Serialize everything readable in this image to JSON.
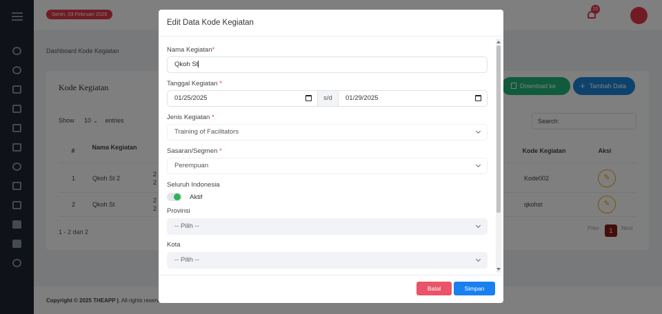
{
  "topbar": {
    "date": "Senin, 03 Februari 2025",
    "notification_count": "20"
  },
  "breadcrumb": "Dashboard Kode Kegiatan",
  "card": {
    "title": "Kode Kegiatan",
    "excel_button": "Download ke Excel",
    "add_button": "Tambah Data",
    "show_label": "Show",
    "entries_value": "10",
    "entries_label": "entries",
    "search_label": "Search:"
  },
  "table": {
    "headers": [
      "#",
      "Nama Kegiatan",
      "Kode Kegiatan",
      "Aksi"
    ],
    "rows": [
      {
        "no": "1",
        "nama": "Qkoh St 2",
        "date_a": "2",
        "date_b": "2",
        "kode": "Kode002"
      },
      {
        "no": "2",
        "nama": "Qkoh St",
        "date_a": "2",
        "date_b": "2",
        "kode": "qkohst"
      }
    ]
  },
  "pagination": {
    "info": "1 - 2 dari 2",
    "prev": "Prev",
    "current": "1",
    "next": "Next"
  },
  "footer": {
    "copyright_bold": "Copyright © 2025 THEAPP |",
    "copyright_rest": ". All rights reserv"
  },
  "modal": {
    "title": "Edit Data Kode Kegiatan",
    "nama_label": "Nama Kegiatan",
    "nama_value": "Qkoh St",
    "tanggal_label": "Tanggal Kegiatan",
    "date_start": "01/25/2025",
    "date_separator": "s/d",
    "date_end": "01/29/2025",
    "jenis_label": "Jenis Kegiatan",
    "jenis_value": "Training of Facilitators",
    "sasaran_label": "Sasaran/Segmen",
    "sasaran_value": "Perempuan",
    "seluruh_label": "Seluruh Indonesia",
    "toggle_label": "Aktif",
    "provinsi_label": "Provinsi",
    "provinsi_placeholder": "-- Pilih --",
    "kota_label": "Kota",
    "kota_placeholder": "-- Pilih --",
    "required_mark": "*",
    "cancel_button": "Batal",
    "save_button": "Simpan"
  },
  "colors": {
    "accent_red": "#e2384b",
    "primary_blue": "#1a7ff0",
    "success_green": "#2fb15a",
    "sidebar_bg": "#1f2533"
  }
}
